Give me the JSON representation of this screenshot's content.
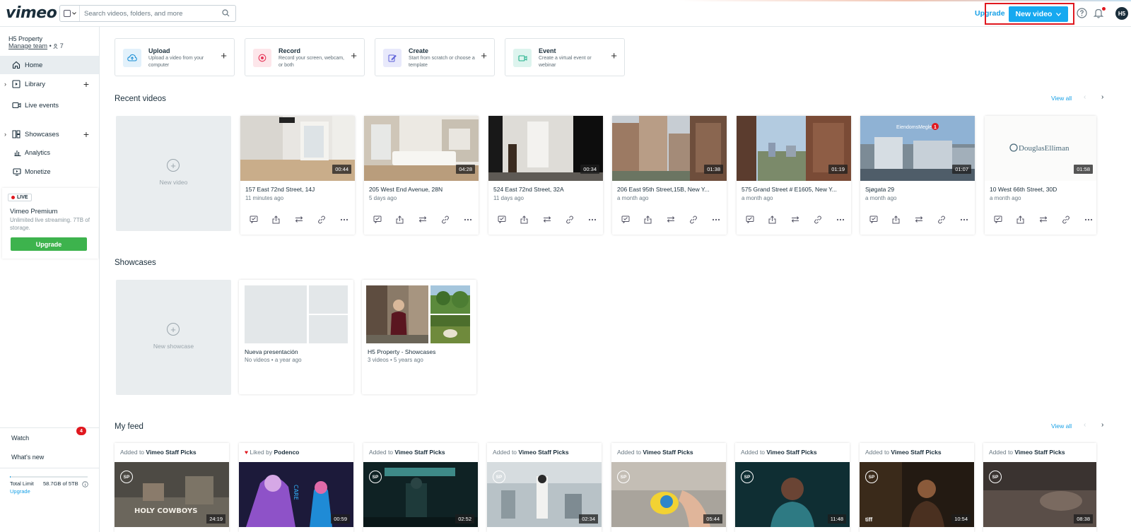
{
  "header": {
    "logo": "vimeo",
    "search_placeholder": "Search videos, folders, and more",
    "upgrade_label": "Upgrade",
    "new_video_label": "New video",
    "avatar_initials": "H5"
  },
  "sidebar": {
    "team_name": "H5 Property",
    "manage_team": "Manage team",
    "team_count": "7",
    "items": [
      {
        "label": "Home"
      },
      {
        "label": "Library"
      },
      {
        "label": "Live events"
      },
      {
        "label": "Showcases"
      },
      {
        "label": "Analytics"
      },
      {
        "label": "Monetize"
      }
    ],
    "live_badge": "LIVE",
    "premium_title": "Vimeo Premium",
    "premium_desc": "Unlimited live streaming. 7TB of storage.",
    "premium_button": "Upgrade",
    "watch": "Watch",
    "whats_new": "What's new",
    "whats_new_count": "4",
    "total_limit_label": "Total Limit",
    "total_limit_value": "58.7GB of 5TB",
    "total_limit_fraction": 0.012,
    "limit_upgrade": "Upgrade"
  },
  "actions": [
    {
      "title": "Upload",
      "desc": "Upload a video from your computer",
      "bg": "#e2f1fb",
      "color": "#1a8fd6"
    },
    {
      "title": "Record",
      "desc": "Record your screen, webcam, or both",
      "bg": "#fde6ea",
      "color": "#e6385a"
    },
    {
      "title": "Create",
      "desc": "Start from scratch or choose a template",
      "bg": "#e8e9fb",
      "color": "#5b5fd8"
    },
    {
      "title": "Event",
      "desc": "Create a virtual event or webinar",
      "bg": "#ddf4ee",
      "color": "#1fb08a"
    }
  ],
  "recent": {
    "title": "Recent videos",
    "view_all": "View all",
    "new_video_label": "New video",
    "videos": [
      {
        "title": "157 East 72nd Street, 14J",
        "meta": "11 minutes ago",
        "duration": "00:44"
      },
      {
        "title": "205 West End Avenue, 28N",
        "meta": "5 days ago",
        "duration": "04:28"
      },
      {
        "title": "524 East 72nd Street, 32A",
        "meta": "11 days ago",
        "duration": "00:34"
      },
      {
        "title": "206 East 95th Street,15B, New Y...",
        "meta": "a month ago",
        "duration": "01:38"
      },
      {
        "title": "575 Grand Street # E1605, New Y...",
        "meta": "a month ago",
        "duration": "01:19"
      },
      {
        "title": "Sjøgata 29",
        "meta": "a month ago",
        "duration": "01:07"
      },
      {
        "title": "10 West 66th Street, 30D",
        "meta": "a month ago",
        "duration": "01:58"
      }
    ],
    "thumb_texts": [
      "EiendomsMegler",
      "DouglasElliman"
    ]
  },
  "showcases": {
    "title": "Showcases",
    "new_showcase_label": "New showcase",
    "items": [
      {
        "title": "Nueva presentación",
        "count": "No videos",
        "age": "a year ago"
      },
      {
        "title": "H5 Property - Showcases",
        "count": "3 videos",
        "age": "5 years ago"
      }
    ]
  },
  "feed": {
    "title": "My feed",
    "view_all": "View all",
    "added_prefix": "Added to",
    "liked_prefix": "Liked by",
    "sp_badge": "SP",
    "thumb_texts": [
      "HOLY COWBOYS",
      "CARE",
      "tiff"
    ],
    "items": [
      {
        "source": "Vimeo Staff Picks",
        "duration": "24:19"
      },
      {
        "source": "Podenco",
        "duration": "00:59"
      },
      {
        "source": "Vimeo Staff Picks",
        "duration": "02:52"
      },
      {
        "source": "Vimeo Staff Picks",
        "duration": "02:34"
      },
      {
        "source": "Vimeo Staff Picks",
        "duration": "05:44"
      },
      {
        "source": "Vimeo Staff Picks",
        "duration": "11:48"
      },
      {
        "source": "Vimeo Staff Picks",
        "duration": "10:54"
      },
      {
        "source": "Vimeo Staff Picks",
        "duration": "08:38"
      }
    ]
  },
  "colors": {
    "accent": "#17a9f0",
    "upgrade_green": "#3db34d",
    "alert_red": "#e0181f"
  }
}
